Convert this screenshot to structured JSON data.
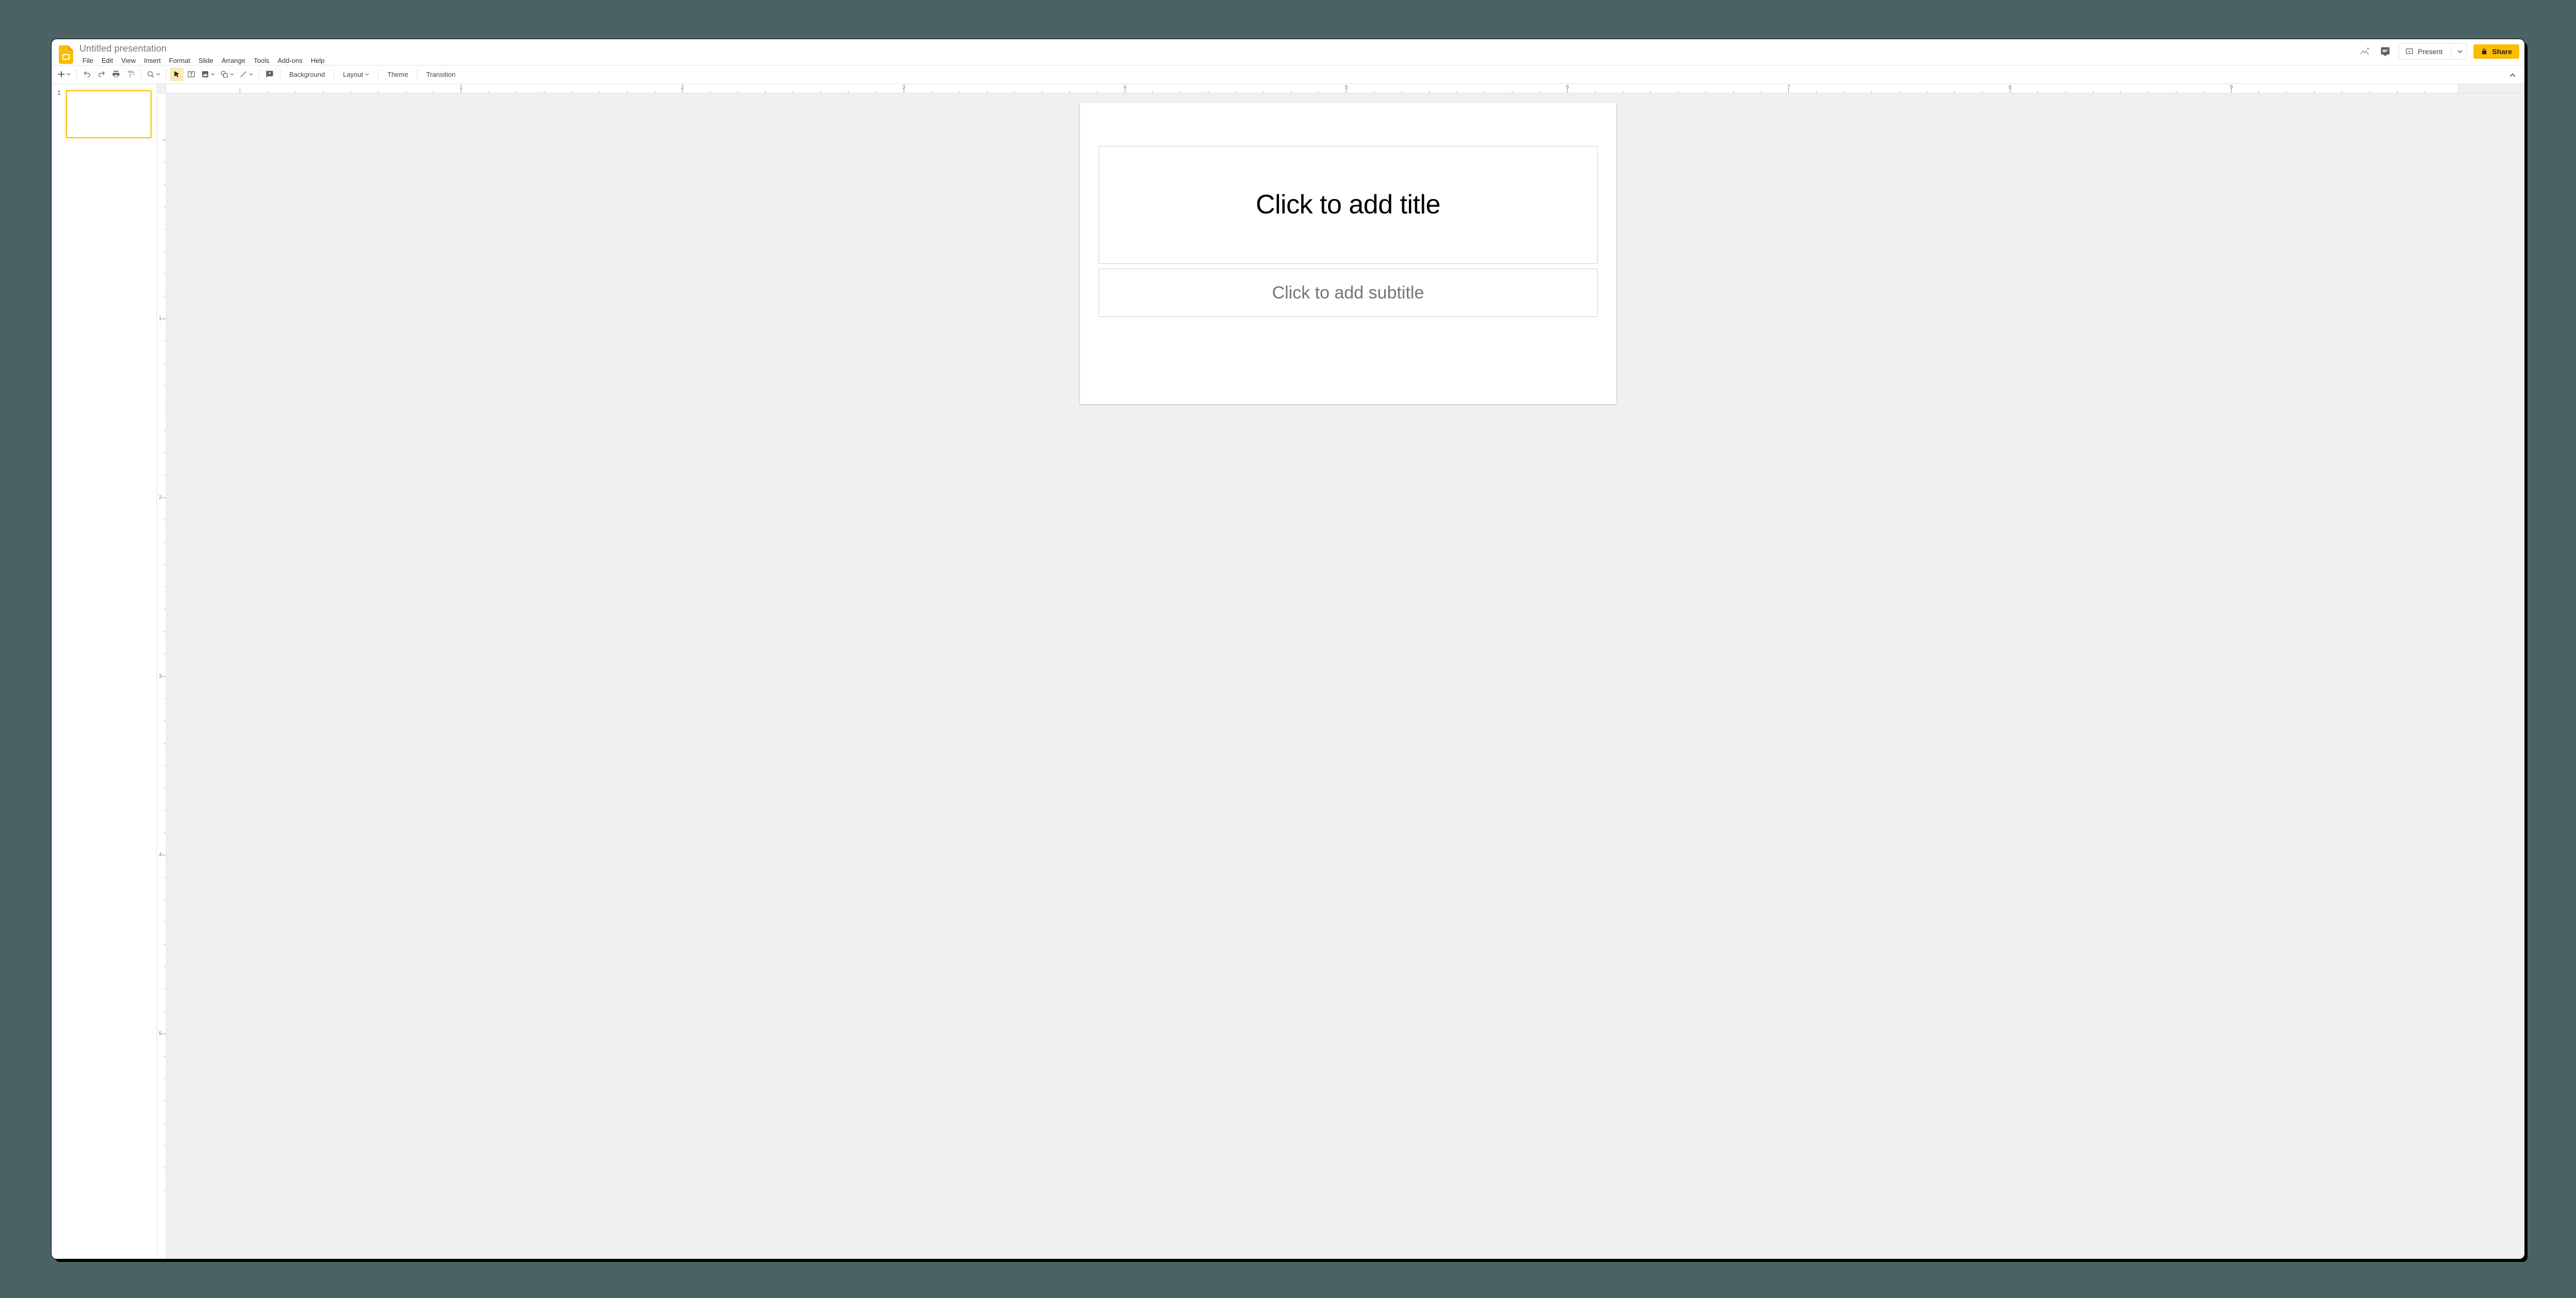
{
  "doc": {
    "title": "Untitled presentation"
  },
  "menus": {
    "file": "File",
    "edit": "Edit",
    "view": "View",
    "insert": "Insert",
    "format": "Format",
    "slide": "Slide",
    "arrange": "Arrange",
    "tools": "Tools",
    "addons": "Add-ons",
    "help": "Help"
  },
  "title_actions": {
    "present": "Present",
    "share": "Share"
  },
  "toolbar": {
    "background": "Background",
    "layout": "Layout",
    "theme": "Theme",
    "transition": "Transition"
  },
  "ruler": {
    "h_labels": [
      "1",
      "2",
      "3",
      "4",
      "5",
      "6",
      "7",
      "8",
      "9"
    ],
    "v_labels": [
      "1",
      "2",
      "3",
      "4",
      "5"
    ]
  },
  "thumbnails": [
    {
      "index": "1"
    }
  ],
  "slide": {
    "title_placeholder": "Click to add title",
    "subtitle_placeholder": "Click to add subtitle"
  }
}
